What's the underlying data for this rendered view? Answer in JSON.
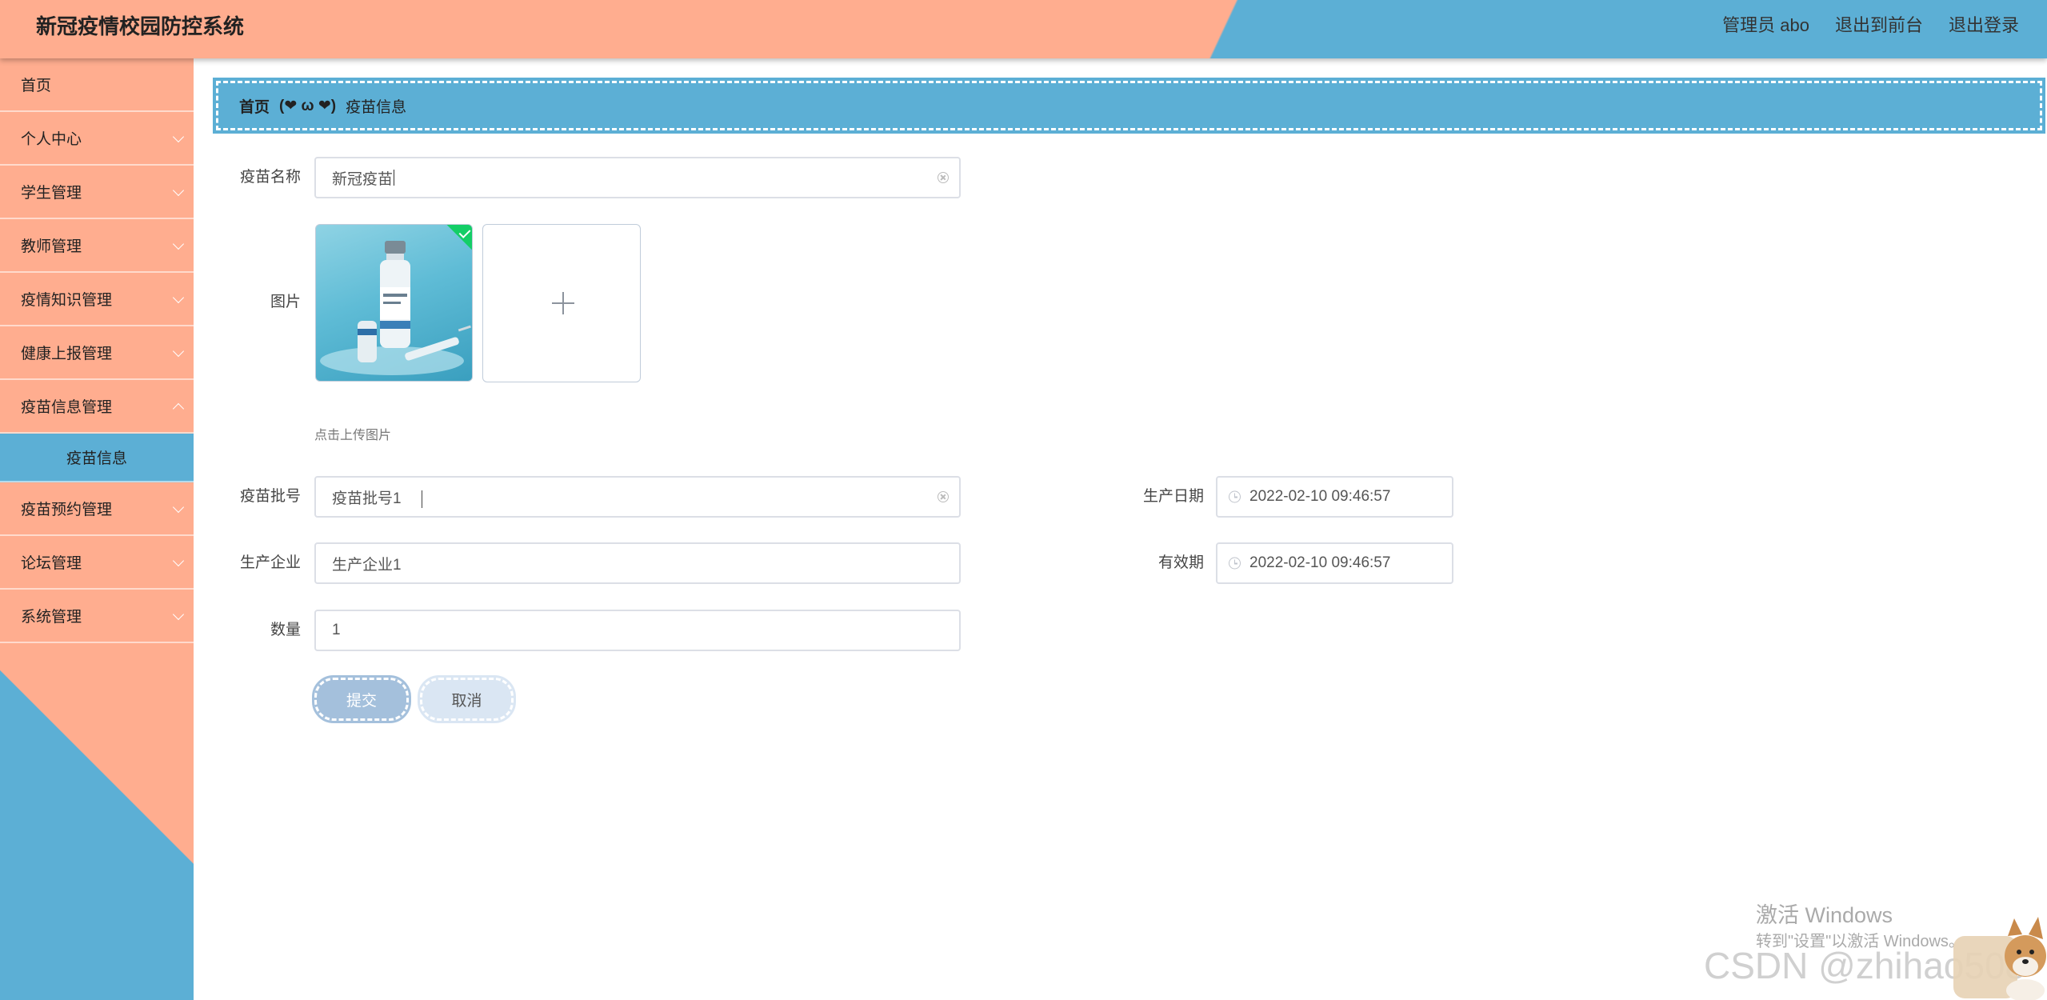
{
  "header": {
    "title": "新冠疫情校园防控系统",
    "user": "管理员 abo",
    "to_front": "退出到前台",
    "logout": "退出登录"
  },
  "sidebar": {
    "items": [
      {
        "label": "首页"
      },
      {
        "label": "个人中心"
      },
      {
        "label": "学生管理"
      },
      {
        "label": "教师管理"
      },
      {
        "label": "疫情知识管理"
      },
      {
        "label": "健康上报管理"
      },
      {
        "label": "疫苗信息管理"
      },
      {
        "label": "疫苗信息"
      },
      {
        "label": "疫苗预约管理"
      },
      {
        "label": "论坛管理"
      },
      {
        "label": "系统管理"
      }
    ]
  },
  "breadcrumb": {
    "home": "首页",
    "separator": "(❤ ω ❤)",
    "current": "疫苗信息"
  },
  "form": {
    "name_label": "疫苗名称",
    "name_value": "新冠疫苗",
    "image_label": "图片",
    "upload_tip": "点击上传图片",
    "batch_label": "疫苗批号",
    "batch_value": "疫苗批号1",
    "prod_date_label": "生产日期",
    "prod_date_value": "2022-02-10 09:46:57",
    "company_label": "生产企业",
    "company_value": "生产企业1",
    "expiry_label": "有效期",
    "expiry_value": "2022-02-10 09:46:57",
    "quantity_label": "数量",
    "quantity_value": "1",
    "submit": "提交",
    "cancel": "取消"
  },
  "watermark": {
    "line1": "激活 Windows",
    "line2": "转到\"设置\"以激活 Windows。",
    "csdn": "CSDN @zhihao508"
  },
  "colors": {
    "salmon": "#ffad8f",
    "blue": "#5cafd5",
    "success": "#13ce66"
  }
}
